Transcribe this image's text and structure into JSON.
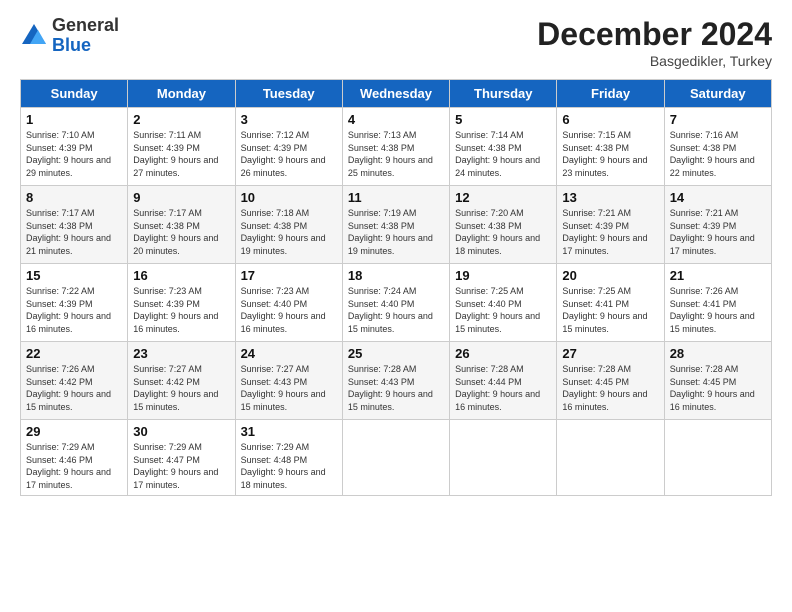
{
  "header": {
    "logo_general": "General",
    "logo_blue": "Blue",
    "month_title": "December 2024",
    "subtitle": "Basgedikler, Turkey"
  },
  "days_of_week": [
    "Sunday",
    "Monday",
    "Tuesday",
    "Wednesday",
    "Thursday",
    "Friday",
    "Saturday"
  ],
  "weeks": [
    [
      {
        "day": "1",
        "sunrise": "Sunrise: 7:10 AM",
        "sunset": "Sunset: 4:39 PM",
        "daylight": "Daylight: 9 hours and 29 minutes."
      },
      {
        "day": "2",
        "sunrise": "Sunrise: 7:11 AM",
        "sunset": "Sunset: 4:39 PM",
        "daylight": "Daylight: 9 hours and 27 minutes."
      },
      {
        "day": "3",
        "sunrise": "Sunrise: 7:12 AM",
        "sunset": "Sunset: 4:39 PM",
        "daylight": "Daylight: 9 hours and 26 minutes."
      },
      {
        "day": "4",
        "sunrise": "Sunrise: 7:13 AM",
        "sunset": "Sunset: 4:38 PM",
        "daylight": "Daylight: 9 hours and 25 minutes."
      },
      {
        "day": "5",
        "sunrise": "Sunrise: 7:14 AM",
        "sunset": "Sunset: 4:38 PM",
        "daylight": "Daylight: 9 hours and 24 minutes."
      },
      {
        "day": "6",
        "sunrise": "Sunrise: 7:15 AM",
        "sunset": "Sunset: 4:38 PM",
        "daylight": "Daylight: 9 hours and 23 minutes."
      },
      {
        "day": "7",
        "sunrise": "Sunrise: 7:16 AM",
        "sunset": "Sunset: 4:38 PM",
        "daylight": "Daylight: 9 hours and 22 minutes."
      }
    ],
    [
      {
        "day": "8",
        "sunrise": "Sunrise: 7:17 AM",
        "sunset": "Sunset: 4:38 PM",
        "daylight": "Daylight: 9 hours and 21 minutes."
      },
      {
        "day": "9",
        "sunrise": "Sunrise: 7:17 AM",
        "sunset": "Sunset: 4:38 PM",
        "daylight": "Daylight: 9 hours and 20 minutes."
      },
      {
        "day": "10",
        "sunrise": "Sunrise: 7:18 AM",
        "sunset": "Sunset: 4:38 PM",
        "daylight": "Daylight: 9 hours and 19 minutes."
      },
      {
        "day": "11",
        "sunrise": "Sunrise: 7:19 AM",
        "sunset": "Sunset: 4:38 PM",
        "daylight": "Daylight: 9 hours and 19 minutes."
      },
      {
        "day": "12",
        "sunrise": "Sunrise: 7:20 AM",
        "sunset": "Sunset: 4:38 PM",
        "daylight": "Daylight: 9 hours and 18 minutes."
      },
      {
        "day": "13",
        "sunrise": "Sunrise: 7:21 AM",
        "sunset": "Sunset: 4:39 PM",
        "daylight": "Daylight: 9 hours and 17 minutes."
      },
      {
        "day": "14",
        "sunrise": "Sunrise: 7:21 AM",
        "sunset": "Sunset: 4:39 PM",
        "daylight": "Daylight: 9 hours and 17 minutes."
      }
    ],
    [
      {
        "day": "15",
        "sunrise": "Sunrise: 7:22 AM",
        "sunset": "Sunset: 4:39 PM",
        "daylight": "Daylight: 9 hours and 16 minutes."
      },
      {
        "day": "16",
        "sunrise": "Sunrise: 7:23 AM",
        "sunset": "Sunset: 4:39 PM",
        "daylight": "Daylight: 9 hours and 16 minutes."
      },
      {
        "day": "17",
        "sunrise": "Sunrise: 7:23 AM",
        "sunset": "Sunset: 4:40 PM",
        "daylight": "Daylight: 9 hours and 16 minutes."
      },
      {
        "day": "18",
        "sunrise": "Sunrise: 7:24 AM",
        "sunset": "Sunset: 4:40 PM",
        "daylight": "Daylight: 9 hours and 15 minutes."
      },
      {
        "day": "19",
        "sunrise": "Sunrise: 7:25 AM",
        "sunset": "Sunset: 4:40 PM",
        "daylight": "Daylight: 9 hours and 15 minutes."
      },
      {
        "day": "20",
        "sunrise": "Sunrise: 7:25 AM",
        "sunset": "Sunset: 4:41 PM",
        "daylight": "Daylight: 9 hours and 15 minutes."
      },
      {
        "day": "21",
        "sunrise": "Sunrise: 7:26 AM",
        "sunset": "Sunset: 4:41 PM",
        "daylight": "Daylight: 9 hours and 15 minutes."
      }
    ],
    [
      {
        "day": "22",
        "sunrise": "Sunrise: 7:26 AM",
        "sunset": "Sunset: 4:42 PM",
        "daylight": "Daylight: 9 hours and 15 minutes."
      },
      {
        "day": "23",
        "sunrise": "Sunrise: 7:27 AM",
        "sunset": "Sunset: 4:42 PM",
        "daylight": "Daylight: 9 hours and 15 minutes."
      },
      {
        "day": "24",
        "sunrise": "Sunrise: 7:27 AM",
        "sunset": "Sunset: 4:43 PM",
        "daylight": "Daylight: 9 hours and 15 minutes."
      },
      {
        "day": "25",
        "sunrise": "Sunrise: 7:28 AM",
        "sunset": "Sunset: 4:43 PM",
        "daylight": "Daylight: 9 hours and 15 minutes."
      },
      {
        "day": "26",
        "sunrise": "Sunrise: 7:28 AM",
        "sunset": "Sunset: 4:44 PM",
        "daylight": "Daylight: 9 hours and 16 minutes."
      },
      {
        "day": "27",
        "sunrise": "Sunrise: 7:28 AM",
        "sunset": "Sunset: 4:45 PM",
        "daylight": "Daylight: 9 hours and 16 minutes."
      },
      {
        "day": "28",
        "sunrise": "Sunrise: 7:28 AM",
        "sunset": "Sunset: 4:45 PM",
        "daylight": "Daylight: 9 hours and 16 minutes."
      }
    ],
    [
      {
        "day": "29",
        "sunrise": "Sunrise: 7:29 AM",
        "sunset": "Sunset: 4:46 PM",
        "daylight": "Daylight: 9 hours and 17 minutes."
      },
      {
        "day": "30",
        "sunrise": "Sunrise: 7:29 AM",
        "sunset": "Sunset: 4:47 PM",
        "daylight": "Daylight: 9 hours and 17 minutes."
      },
      {
        "day": "31",
        "sunrise": "Sunrise: 7:29 AM",
        "sunset": "Sunset: 4:48 PM",
        "daylight": "Daylight: 9 hours and 18 minutes."
      },
      null,
      null,
      null,
      null
    ]
  ]
}
